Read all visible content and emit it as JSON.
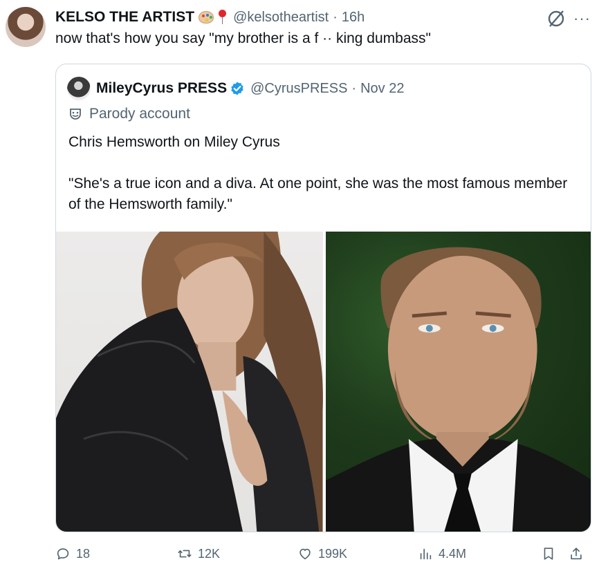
{
  "tweet": {
    "author_name": "KELSO THE ARTIST",
    "handle": "@kelsotheartist",
    "separator": "·",
    "time": "16h",
    "text": "now that's how you say \"my brother is a f ·· king dumbass\"",
    "more_label": "···"
  },
  "quote": {
    "author_name": "MileyCyrus PRESS",
    "handle": "@CyrusPRESS",
    "separator": "·",
    "time": "Nov 22",
    "parody_label": "Parody account",
    "text": "Chris Hemsworth on Miley Cyrus\n\n\"She's a true icon and a diva. At one point, she was the most famous member of the Hemsworth family.\""
  },
  "actions": {
    "replies": "18",
    "reposts": "12K",
    "likes": "199K",
    "views": "4.4M"
  },
  "icons": [
    "palette-emoji",
    "pin-emoji",
    "grok-icon",
    "more-icon",
    "verified-icon",
    "parody-mask-icon",
    "reply-icon",
    "repost-icon",
    "like-icon",
    "views-icon",
    "bookmark-icon",
    "share-icon"
  ],
  "colors": {
    "text": "#0f1419",
    "secondary": "#536471",
    "border": "#cfd9de",
    "verified": "#1d9bf0"
  }
}
